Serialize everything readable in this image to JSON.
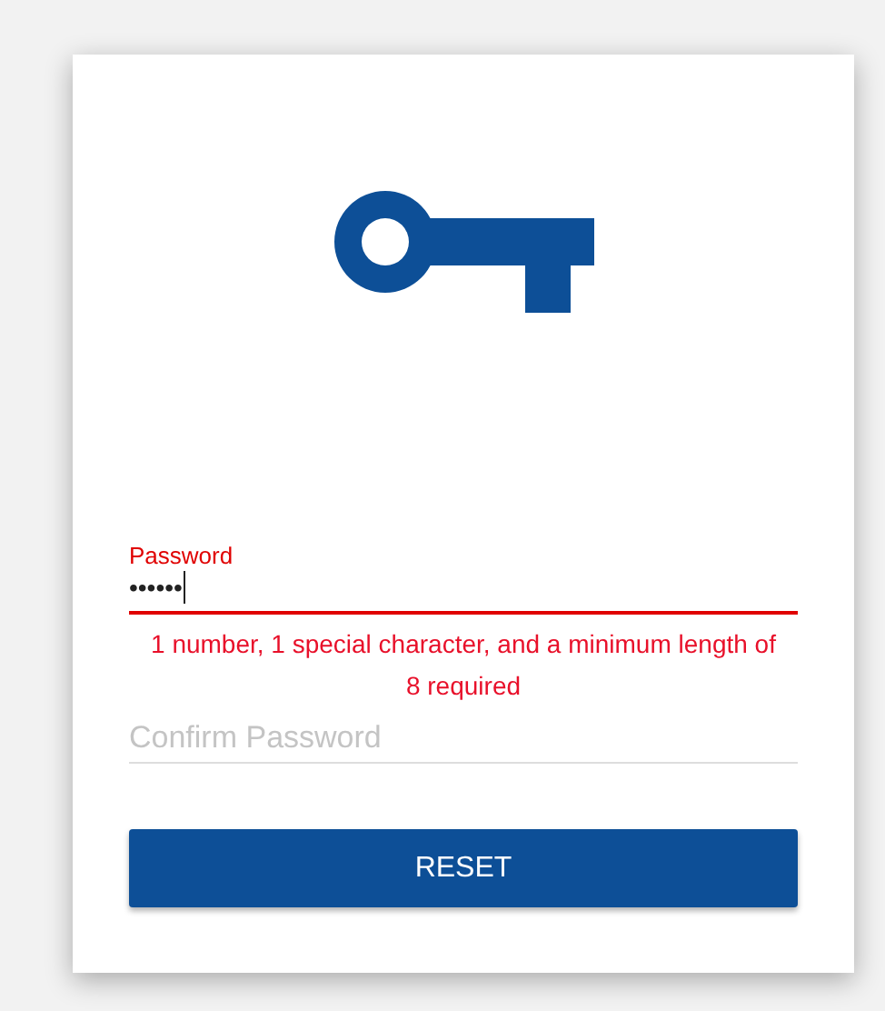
{
  "fields": [
    {
      "label": "Password",
      "value": "••••••",
      "focused": true,
      "invalid": true,
      "error": "1 number, 1 special character, and a minimum length of 8 required"
    },
    {
      "placeholder": "Confirm Password",
      "focused": false,
      "invalid": false
    }
  ],
  "button": {
    "label": "RESET"
  }
}
